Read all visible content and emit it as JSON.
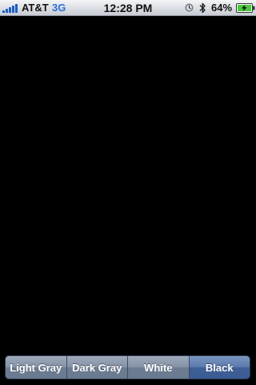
{
  "status_bar": {
    "carrier": "AT&T",
    "network": "3G",
    "time": "12:28 PM",
    "battery_percent": "64%",
    "signal_bars": 5,
    "icons": [
      "signal-icon",
      "alarm-icon",
      "bluetooth-icon",
      "battery-charging-icon"
    ],
    "colors": {
      "signal": "#1d5fc5",
      "network": "#2f6fd6",
      "battery_fill": "#49c93b"
    }
  },
  "content": {
    "background": "#000000"
  },
  "segmented_control": {
    "segments": [
      {
        "label": "Light Gray",
        "selected": false
      },
      {
        "label": "Dark Gray",
        "selected": false
      },
      {
        "label": "White",
        "selected": false
      },
      {
        "label": "Black",
        "selected": true
      }
    ],
    "colors": {
      "unselected": "#8391a5",
      "selected": "#4a6aa0"
    }
  }
}
